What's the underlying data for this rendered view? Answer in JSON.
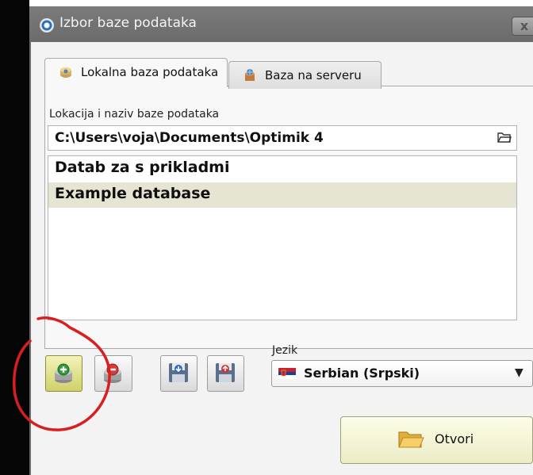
{
  "window": {
    "title": "Izbor baze podataka",
    "close_glyph": "x"
  },
  "tabs": [
    {
      "label": "Lokalna baza podataka",
      "icon": "local-db-icon",
      "active": true
    },
    {
      "label": "Baza na serveru",
      "icon": "server-db-icon",
      "active": false
    }
  ],
  "location": {
    "label": "Lokacija i naziv baze podataka",
    "path": "C:\\Users\\voja\\Documents\\Optimik 4"
  },
  "databases": [
    {
      "name": "Datab za s prikladmi",
      "selected": false
    },
    {
      "name": "Example database",
      "selected": true
    }
  ],
  "toolbar": {
    "add_icon": "add-database-icon",
    "remove_icon": "remove-database-icon",
    "save_icon": "backup-database-icon",
    "restore_icon": "restore-database-icon"
  },
  "language": {
    "label": "Jezik",
    "value": "Serbian (Srpski)",
    "chevron": "▼"
  },
  "open_button": {
    "label": "Otvori"
  },
  "colors": {
    "selected_row": "#e6e4d3",
    "annotation": "#d81f1f",
    "titlebar": "#6f6f6f"
  }
}
